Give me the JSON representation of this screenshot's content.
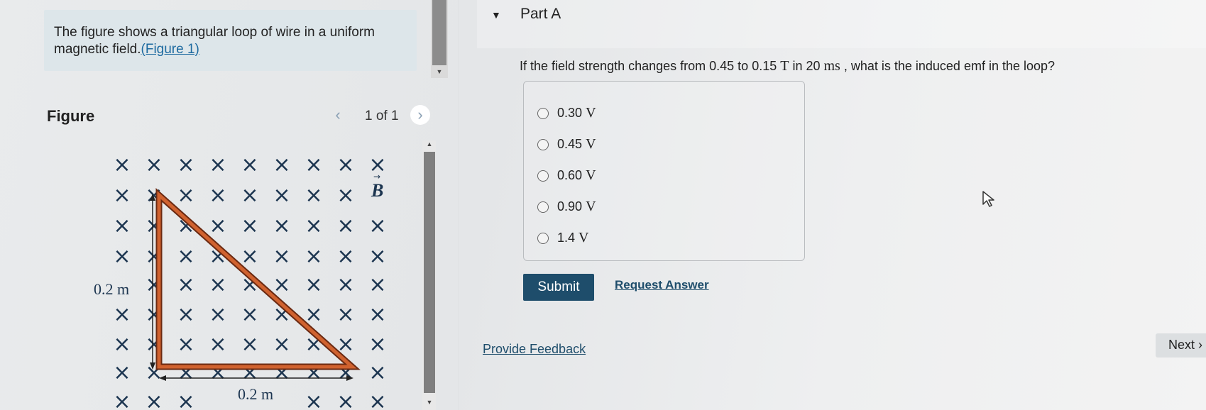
{
  "intro": {
    "text": "The figure shows a triangular loop of wire in a uniform magnetic field.",
    "figure_link": "(Figure 1)"
  },
  "figure_panel": {
    "title": "Figure",
    "counter": "1 of 1",
    "prev_icon": "‹",
    "next_icon": "›",
    "labels": {
      "field": "B",
      "vertical_side": "0.2 m",
      "horizontal_side": "0.2 m"
    },
    "field_symbol": "×"
  },
  "part": {
    "toggle_icon": "▼",
    "label": "Part A",
    "question_prefix": "If the field strength changes from 0.45 to 0.15 ",
    "unit_T": "T",
    "question_mid": " in 20 ",
    "unit_ms": "ms",
    "question_suffix": " , what is the induced emf in the loop?",
    "options": [
      {
        "value": "0.30",
        "unit": "V"
      },
      {
        "value": "0.45",
        "unit": "V"
      },
      {
        "value": "0.60",
        "unit": "V"
      },
      {
        "value": "0.90",
        "unit": "V"
      },
      {
        "value": "1.4",
        "unit": "V"
      }
    ],
    "submit_label": "Submit",
    "request_label": "Request Answer"
  },
  "footer": {
    "feedback_label": "Provide Feedback",
    "next_label": "Next ›"
  },
  "colors": {
    "primary_button": "#1e4d6b",
    "link": "#1d6aa0",
    "wire": "#c0542a",
    "field_x": "#1c3550"
  }
}
